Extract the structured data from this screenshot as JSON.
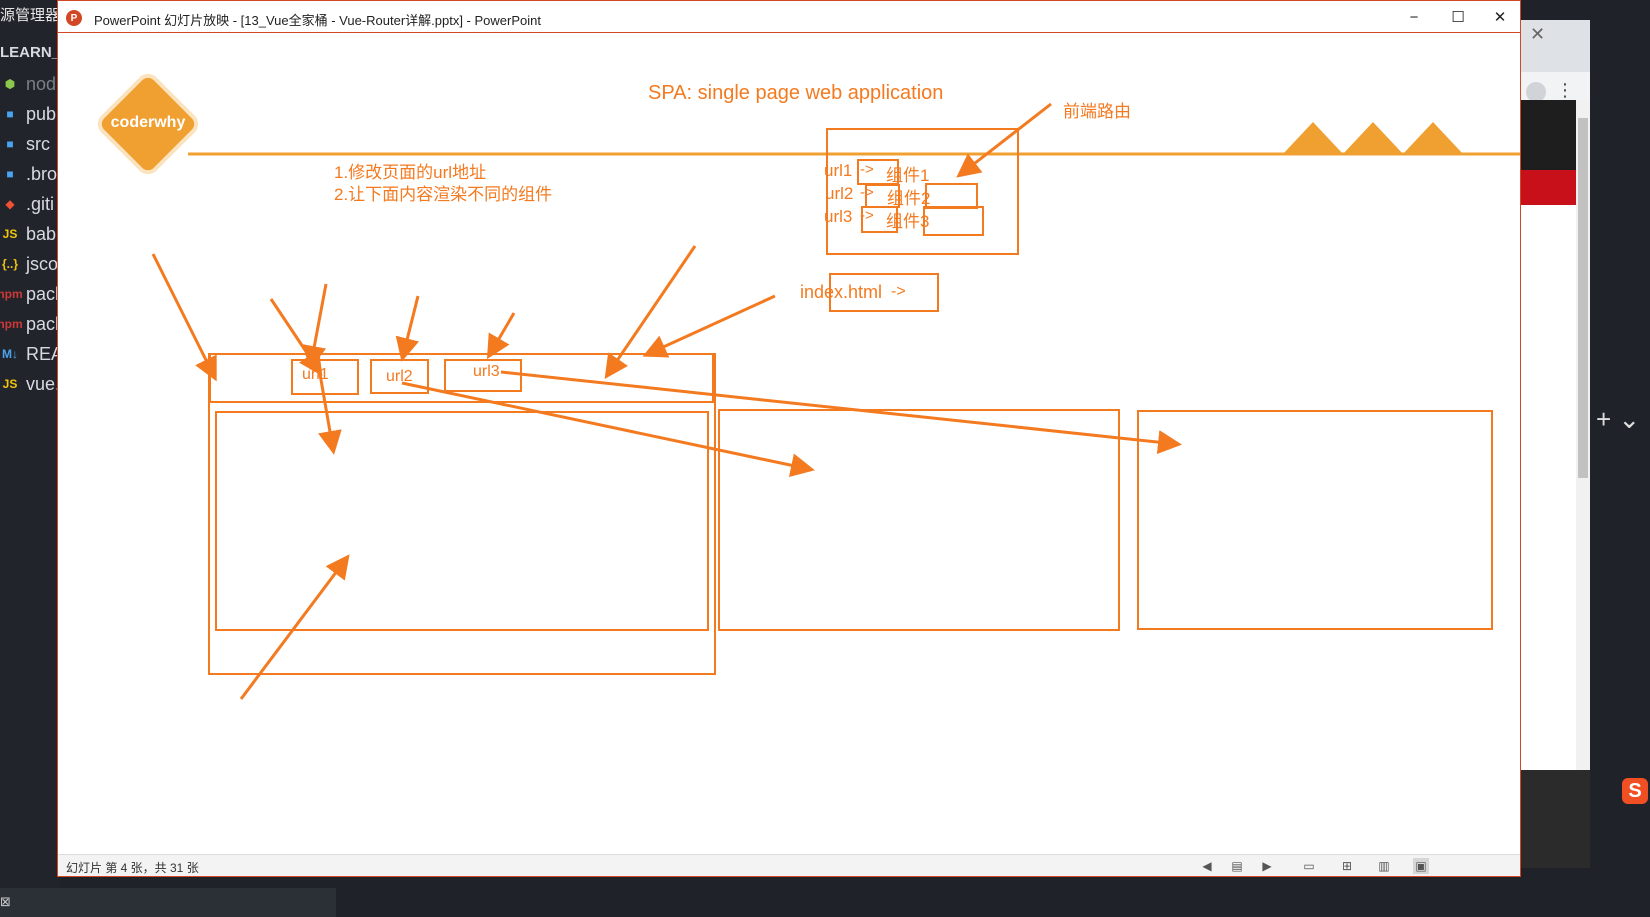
{
  "explorer": {
    "title": "源管理器",
    "folder": "LEARN_",
    "items": [
      {
        "icon": "node-icon",
        "glyph": "⬢",
        "label": "nod",
        "color": "#8cc84b",
        "dim": true
      },
      {
        "icon": "folder-icon",
        "glyph": "■",
        "label": "pub",
        "color": "#4aa3f0"
      },
      {
        "icon": "folder-icon",
        "glyph": "■",
        "label": "src",
        "color": "#4aa3f0"
      },
      {
        "icon": "file-icon",
        "glyph": "■",
        "label": ".bro",
        "color": "#4aa3f0"
      },
      {
        "icon": "git-icon",
        "glyph": "◆",
        "label": ".giti",
        "color": "#f05133"
      },
      {
        "icon": "js-icon",
        "glyph": "JS",
        "label": "bab",
        "color": "#f1c40f"
      },
      {
        "icon": "json-icon",
        "glyph": "{..}",
        "label": "jsco",
        "color": "#f1c40f"
      },
      {
        "icon": "npm-icon",
        "glyph": "npm",
        "label": "pacl",
        "color": "#cb3837"
      },
      {
        "icon": "npm-icon",
        "glyph": "npm",
        "label": "pacl",
        "color": "#cb3837"
      },
      {
        "icon": "markdown-icon",
        "glyph": "M↓",
        "label": "REA",
        "color": "#4aa3f0"
      },
      {
        "icon": "js-icon",
        "glyph": "JS",
        "label": "vue.",
        "color": "#f1c40f"
      }
    ],
    "bottom_icon": "terminal-icon"
  },
  "window": {
    "title": "PowerPoint 幻灯片放映 - [13_Vue全家桶 - Vue-Router详解.pptx] - PowerPoint",
    "app_icon": "P",
    "minimize": "−",
    "maximize": "☐",
    "close": "✕"
  },
  "slide": {
    "logo": "coderwhy",
    "title": "SPA: single page web application",
    "front_route_label": "前端路由",
    "steps": [
      "1.修改页面的url地址",
      "2.让下面内容渲染不同的组件"
    ],
    "mapping": [
      {
        "url": "url1",
        "arrow": "->",
        "component": "组件1"
      },
      {
        "url": "url2",
        "arrow": "->",
        "component": "组件2"
      },
      {
        "url": "url3",
        "arrow": "->",
        "component": "组件3"
      }
    ],
    "index_box": "index.html",
    "index_arrow": "->",
    "nav_links": [
      "url1",
      "url2",
      "url3"
    ],
    "accent_color": "#f47a20",
    "logo_color": "#f0a030"
  },
  "statusbar": {
    "slide_info": "幻灯片 第 4 张，共 31 张"
  },
  "browser": {
    "close": "✕",
    "menu": "⋮"
  },
  "terminal": {
    "add": "+ ⌄"
  },
  "ime": {
    "label": "S"
  }
}
